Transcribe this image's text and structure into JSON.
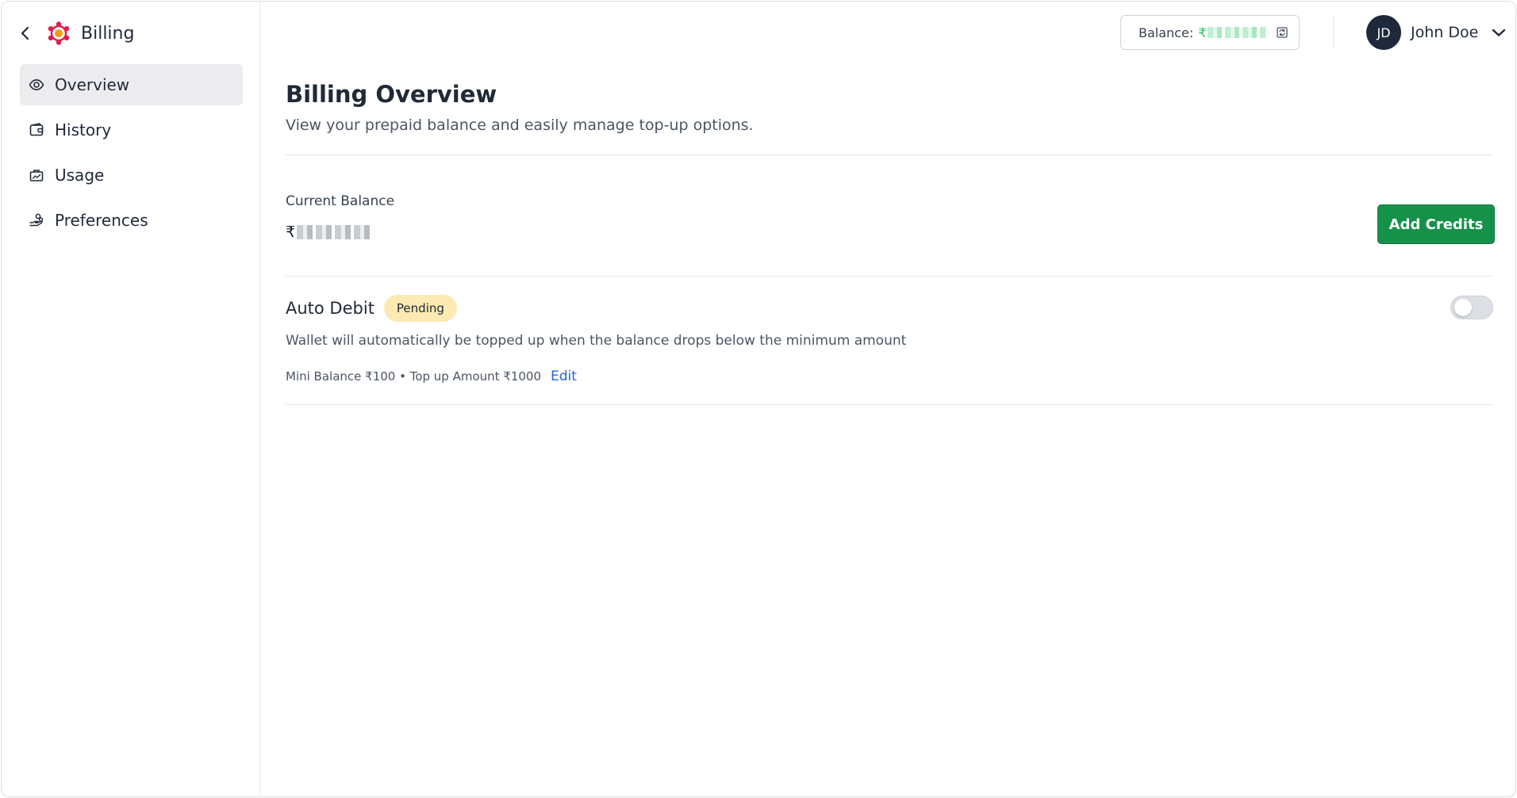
{
  "sidebar": {
    "title": "Billing",
    "items": [
      {
        "label": "Overview",
        "icon": "eye-icon",
        "active": true
      },
      {
        "label": "History",
        "icon": "wallet-icon",
        "active": false
      },
      {
        "label": "Usage",
        "icon": "briefcase-chart-icon",
        "active": false
      },
      {
        "label": "Preferences",
        "icon": "hand-coins-icon",
        "active": false
      }
    ]
  },
  "topbar": {
    "balance_label": "Balance:",
    "balance_currency": "₹",
    "user": {
      "initials": "JD",
      "name": "John Doe"
    }
  },
  "main": {
    "title": "Billing Overview",
    "subtitle": "View your prepaid balance and easily manage top-up options.",
    "current_balance": {
      "label": "Current Balance",
      "currency": "₹"
    },
    "add_credits_label": "Add Credits",
    "auto_debit": {
      "title": "Auto Debit",
      "status": "Pending",
      "enabled": false,
      "description": "Wallet will automatically be topped up when the balance drops below the minimum amount",
      "meta": "Mini Balance ₹100 • Top up Amount ₹1000",
      "edit_label": "Edit"
    }
  },
  "colors": {
    "accent_green": "#16914a",
    "badge_yellow": "#fdeab3",
    "link_blue": "#2563eb",
    "avatar_bg": "#1e293b",
    "active_nav_bg": "#ececef"
  }
}
